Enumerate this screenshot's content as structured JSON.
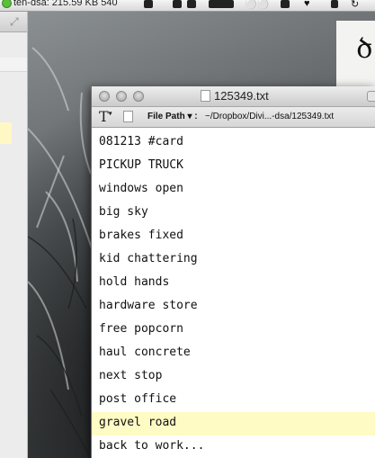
{
  "menubar": {
    "status_text": "ten-dsa: 215.59 KB  540",
    "icons": [
      "dropbox-icon",
      "evernote-icon",
      "music-icon",
      "playback-icon",
      "glasses-icon",
      "figure-icon",
      "heart-icon",
      "lock-icon",
      "time-machine-icon"
    ]
  },
  "window": {
    "title": "125349.txt",
    "toolbar": {
      "text_tool": "T",
      "file_path_label": "File Path",
      "file_path_value": "~/Dropbox/Divi...-dsa/125349.txt"
    }
  },
  "document": {
    "lines": [
      "081213 #card",
      "PICKUP TRUCK",
      "windows open",
      "big sky",
      "brakes fixed",
      "kid chattering",
      "hold hands",
      "hardware store",
      "free popcorn",
      "haul concrete",
      "next stop",
      "post office",
      "gravel road",
      "back to work..."
    ],
    "current_line_index": 12
  },
  "background_photo": {
    "corner_glyph": "ծ"
  },
  "colors": {
    "current_line_highlight": "#fffbc4",
    "window_background": "#ffffff"
  }
}
